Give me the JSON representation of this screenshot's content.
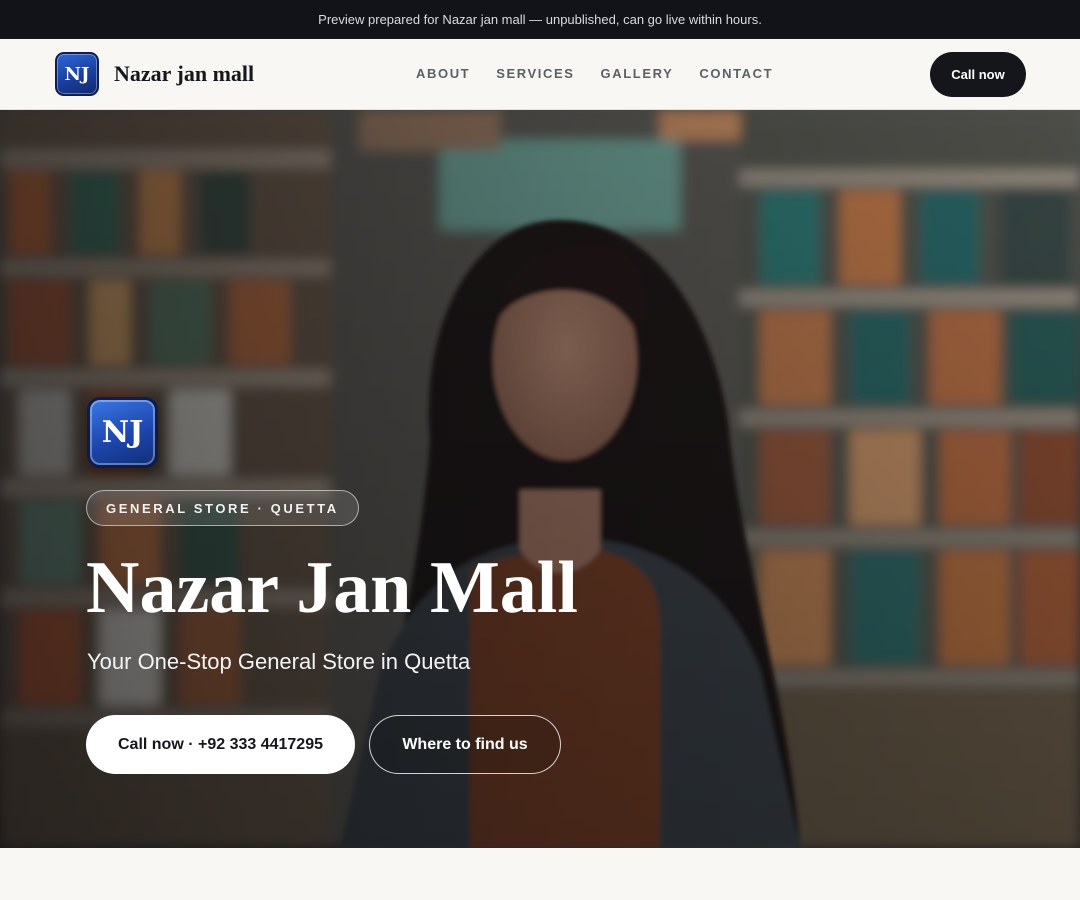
{
  "banner": {
    "text": "Preview prepared for Nazar jan mall — unpublished, can go live within hours."
  },
  "header": {
    "logo_initials": "NJ",
    "brand_name": "Nazar jan mall",
    "nav": [
      {
        "label": "ABOUT"
      },
      {
        "label": "SERVICES"
      },
      {
        "label": "GALLERY"
      },
      {
        "label": "CONTACT"
      }
    ],
    "cta_label": "Call now"
  },
  "hero": {
    "logo_initials": "NJ",
    "tag": "GENERAL STORE · QUETTA",
    "title": "Nazar Jan Mall",
    "subtitle": "Your One-Stop General Store in Quetta",
    "primary_button": "Call now · +92 333 4417295",
    "secondary_button": "Where to find us",
    "background_image": "woman-in-supermarket-aisle-photo"
  },
  "colors": {
    "dark": "#14161b",
    "logo_blue": "#1d47ad",
    "page_bg": "#f8f7f3"
  }
}
